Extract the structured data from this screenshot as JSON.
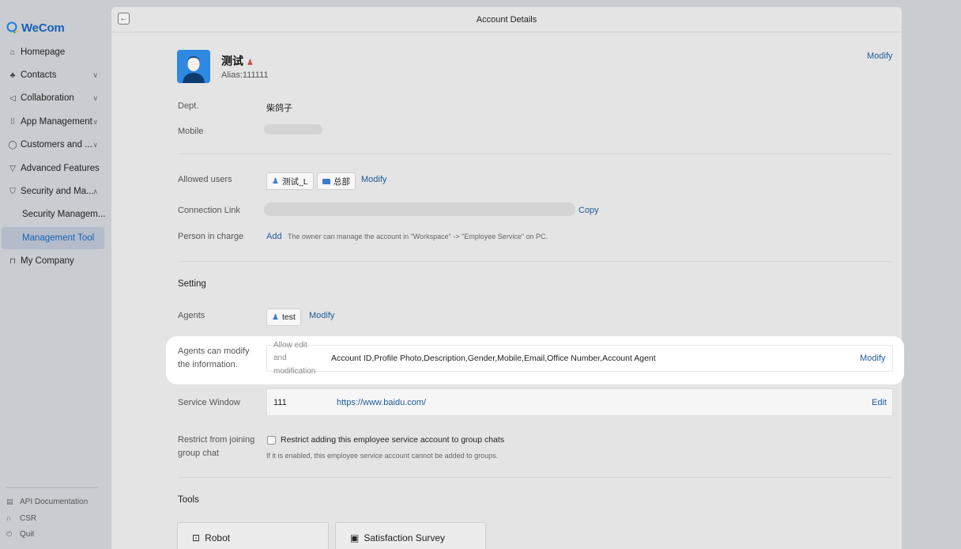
{
  "app": {
    "logo_text": "WeCom"
  },
  "sidebar": {
    "items": [
      {
        "label": "Homepage",
        "icon": "home-icon"
      },
      {
        "label": "Contacts",
        "icon": "contacts-icon"
      },
      {
        "label": "Collaboration",
        "icon": "collaboration-icon"
      },
      {
        "label": "App Management",
        "icon": "apps-grid-icon"
      },
      {
        "label": "Customers and ...",
        "icon": "chat-bubble-icon"
      },
      {
        "label": "Advanced Features",
        "icon": "filter-icon"
      },
      {
        "label": "Security and Ma...",
        "icon": "shield-icon"
      },
      {
        "label": "Security Managem..."
      },
      {
        "label": "Management Tool"
      },
      {
        "label": "My Company",
        "icon": "company-icon"
      }
    ],
    "footer": [
      {
        "label": "API Documentation",
        "icon": "document-icon"
      },
      {
        "label": "CSR",
        "icon": "headset-icon"
      },
      {
        "label": "Quit",
        "icon": "power-icon"
      }
    ]
  },
  "header": {
    "title": "Account Details"
  },
  "profile": {
    "name": "测试",
    "alias": "Alias:111111",
    "modify_label": "Modify"
  },
  "fields": {
    "dept_label": "Dept.",
    "dept_value": "柴鸽子",
    "mobile_label": "Mobile",
    "allowed_users_label": "Allowed users",
    "allowed_users": [
      "测试_L",
      "总部"
    ],
    "allowed_users_modify": "Modify",
    "connection_link_label": "Connection Link",
    "copy_label": "Copy",
    "person_in_charge_label": "Person in charge",
    "add_label": "Add",
    "person_in_charge_hint": "The owner can manage the account in \"Workspace\" -> \"Employee Service\" on PC."
  },
  "setting": {
    "title": "Setting",
    "agents_label": "Agents",
    "agent_chip": "test",
    "agents_modify": "Modify",
    "agents_can_modify_label_1": "Agents can modify",
    "agents_can_modify_label_2": "the information.",
    "allow_edit_1": "Allow edit",
    "allow_edit_2": "and",
    "allow_edit_3": "modification",
    "allowed_fields": "Account ID,Profile Photo,Description,Gender,Mobile,Email,Office Number,Account Agent",
    "allowed_modify": "Modify",
    "service_window_label": "Service Window",
    "service_window_name": "111",
    "service_window_url": "https://www.baidu.com/",
    "service_window_edit": "Edit",
    "restrict_label_1": "Restrict from joining",
    "restrict_label_2": "group chat",
    "restrict_checkbox_label": "Restrict adding this employee service account to group chats",
    "restrict_checked": false,
    "restrict_hint": "If it is enabled, this employee service account cannot be added to groups."
  },
  "tools": {
    "title": "Tools",
    "cards": [
      {
        "label": "Robot",
        "icon": "robot-icon"
      },
      {
        "label": "Satisfaction Survey",
        "icon": "survey-icon"
      }
    ]
  },
  "colors": {
    "link": "#1e5a9c",
    "active_nav": "#1664b8",
    "avatar_bg": "#2f89e3"
  }
}
